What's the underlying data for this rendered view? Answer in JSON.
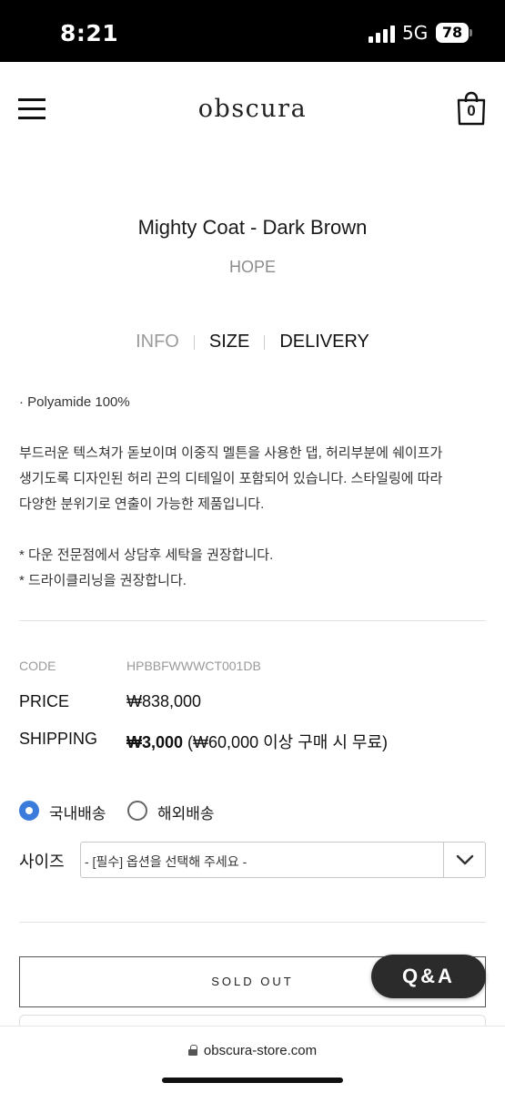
{
  "status_bar": {
    "time": "8:21",
    "network": "5G",
    "battery": "78"
  },
  "header": {
    "logo": "obscura",
    "cart_count": "0"
  },
  "product": {
    "title": "Mighty Coat - Dark Brown",
    "brand": "HOPE"
  },
  "tabs": [
    {
      "label": "INFO",
      "active": false
    },
    {
      "label": "SIZE",
      "active": true
    },
    {
      "label": "DELIVERY",
      "active": true
    }
  ],
  "info": {
    "material": "· Polyamide 100%",
    "description_lines": [
      "부드러운 텍스쳐가 돋보이며 이중직 멜튼을 사용한 댑, 허리부분에 쉐이프가",
      "생기도록 디자인된 허리 끈의 디테일이 포함되어 있습니다. 스타일링에 따라",
      "다양한 분위기로 연출이 가능한 제품입니다."
    ],
    "care_lines": [
      "* 다운 전문점에서 상담후 세탁을 권장합니다.",
      "* 드라이클리닝을 권장합니다."
    ]
  },
  "details": {
    "code_label": "CODE",
    "code_value": "HPBBFWWWCT001DB",
    "price_label": "PRICE",
    "price_value": "₩838,000",
    "shipping_label": "SHIPPING",
    "shipping_value": "₩3,000",
    "shipping_note": " (₩60,000 이상 구매 시 무료)"
  },
  "shipping_options": [
    {
      "label": "국내배송",
      "checked": true
    },
    {
      "label": "해외배송",
      "checked": false
    }
  ],
  "size": {
    "label": "사이즈",
    "placeholder": "- [필수] 옵션을 선택해 주세요 -"
  },
  "actions": {
    "soldout_label": "SOLD OUT",
    "qa_label": "Q&A"
  },
  "browser": {
    "url": "obscura-store.com"
  },
  "colors": {
    "radio_accent": "#3b7bdc",
    "qa_background": "#2b2b2b"
  }
}
